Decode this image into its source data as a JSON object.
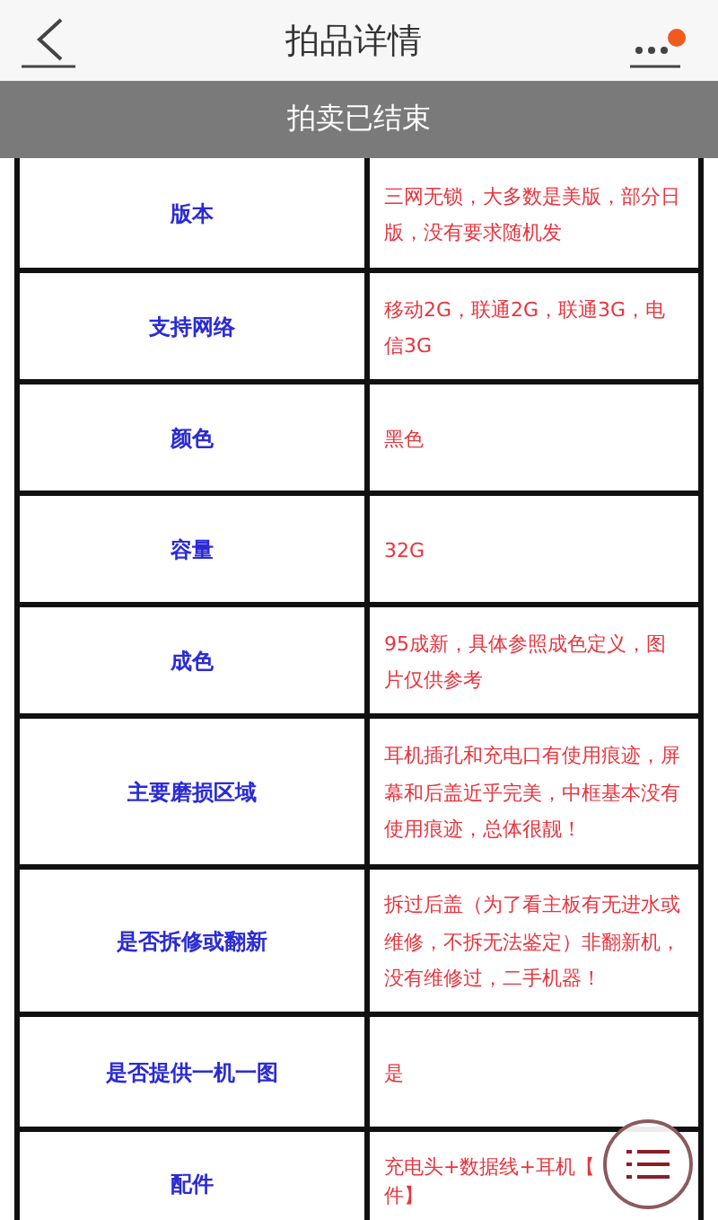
{
  "header": {
    "title": "拍品详情",
    "has_notification": true
  },
  "banner": "拍卖已结束",
  "rows": [
    {
      "label": "版本",
      "value": "三网无锁，大多数是美版，部分日版，没有要求随机发"
    },
    {
      "label": "支持网络",
      "value": "移动2G，联通2G，联通3G，电信3G"
    },
    {
      "label": "颜色",
      "value": "黑色"
    },
    {
      "label": "容量",
      "value": "32G"
    },
    {
      "label": "成色",
      "value": "95成新，具体参照成色定义，图片仅供参考"
    },
    {
      "label": "主要磨损区域",
      "value": "耳机插孔和充电口有使用痕迹，屏幕和后盖近乎完美，中框基本没有使用痕迹，总体很靓！"
    },
    {
      "label": "是否拆修或翻新",
      "value": "拆过后盖（为了看主板有无进水或维修，不拆无法鉴定）非翻新机，没有维修过，二手机器！"
    },
    {
      "label": "是否提供一机一图",
      "value": "是"
    },
    {
      "label": "配件",
      "value_lines": [
        "充电头+数据线+耳机【",
        "件】"
      ]
    }
  ]
}
